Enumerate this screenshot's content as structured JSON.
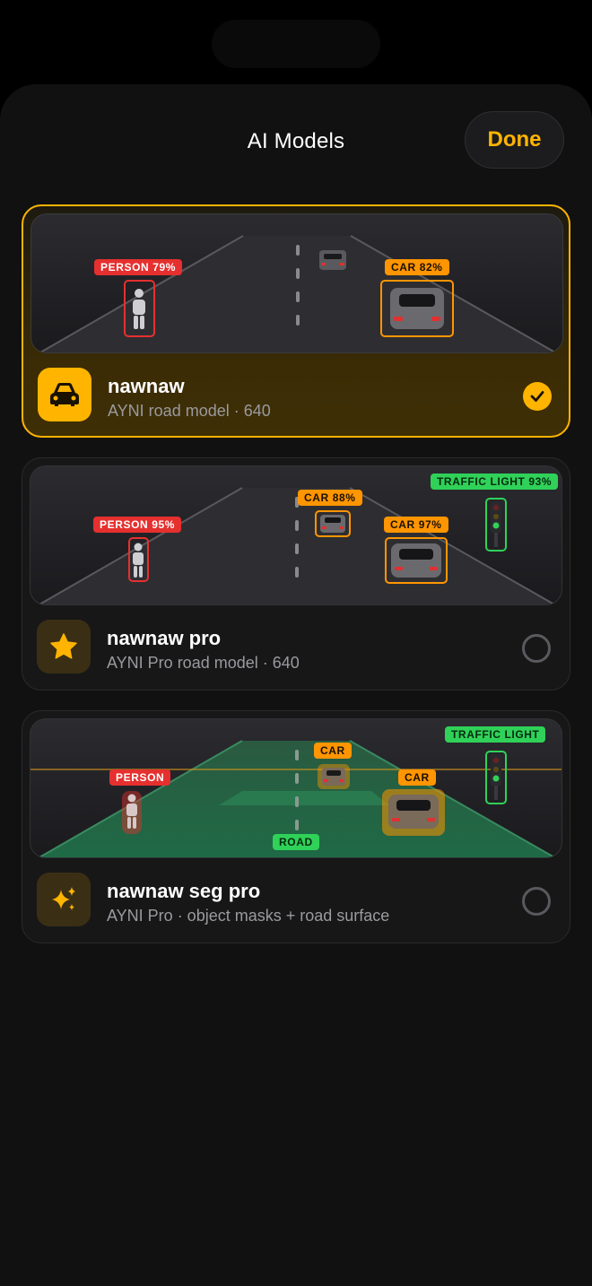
{
  "header": {
    "title": "AI Models",
    "done_label": "Done"
  },
  "colors": {
    "accent": "#ffb400",
    "person": "#e5302f",
    "car": "#ff9500",
    "traffic_light": "#30d158"
  },
  "models": [
    {
      "name": "nawnaw",
      "description": "AYNI road model · 640",
      "icon": "car-icon",
      "selected": true,
      "detections": {
        "person": "PERSON 79%",
        "car_near": "CAR 82%"
      }
    },
    {
      "name": "nawnaw pro",
      "description": "AYNI Pro road model · 640",
      "icon": "star-icon",
      "selected": false,
      "detections": {
        "person": "PERSON 95%",
        "car_far": "CAR 88%",
        "car_near": "CAR 97%",
        "traffic_light": "TRAFFIC LIGHT 93%"
      }
    },
    {
      "name": "nawnaw seg pro",
      "description": "AYNI Pro · object masks + road surface",
      "icon": "sparkles-icon",
      "selected": false,
      "detections": {
        "person": "PERSON",
        "car_far": "CAR",
        "car_near": "CAR",
        "traffic_light": "TRAFFIC LIGHT",
        "road": "ROAD"
      }
    }
  ]
}
